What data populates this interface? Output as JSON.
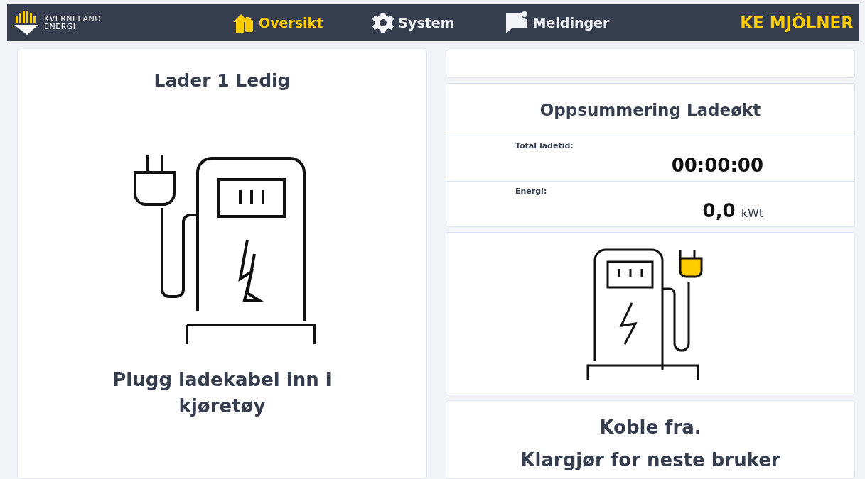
{
  "logo": {
    "line_1": "KVERNELAND",
    "line_2": "ENERGI"
  },
  "nav": [
    {
      "kind": "overview",
      "label": "Oversikt",
      "selected": true
    },
    {
      "kind": "system",
      "label": "System",
      "selected": false
    },
    {
      "kind": "messages",
      "label": "Meldinger",
      "selected": false
    }
  ],
  "station_name": "KE MJÖLNER",
  "charger": {
    "title": "Lader 1 Ledig",
    "instruction": "Plugg ladekabel inn i kjøretøy"
  },
  "summary": {
    "title": "Oppsummering Ladeøkt",
    "rows": [
      {
        "label": "Total ladetid:",
        "value": "00:00:00"
      },
      {
        "label": "Energi:",
        "value": "0,0",
        "unit": "kWt"
      }
    ]
  },
  "status": {
    "lines": [
      "Koble fra.",
      "Klargjør for neste bruker"
    ]
  }
}
